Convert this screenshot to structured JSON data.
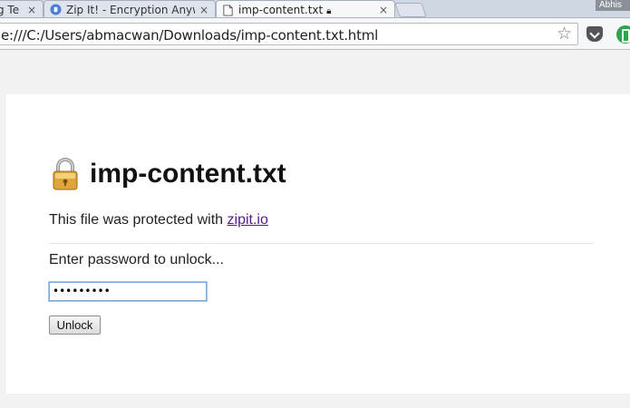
{
  "tabs": [
    {
      "title": "g Te",
      "close": "×"
    },
    {
      "title": "Zip It! - Encryption Anywh",
      "close": "×"
    },
    {
      "title": "imp-content.txt",
      "close": "×"
    }
  ],
  "profile": {
    "name": "Abhis"
  },
  "address_bar": {
    "url": "le:///C:/Users/abmacwan/Downloads/imp-content.txt.html"
  },
  "page": {
    "title": "imp-content.txt",
    "protected_prefix": "This file was protected with ",
    "protected_link": "zipit.io",
    "prompt": "Enter password to unlock...",
    "password_value": "•••••••••",
    "unlock_label": "Unlock"
  }
}
